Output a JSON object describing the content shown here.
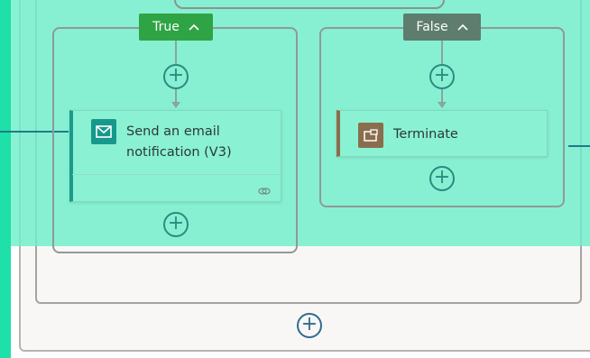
{
  "branches": {
    "true": {
      "label": "True",
      "chevron": "^"
    },
    "false": {
      "label": "False",
      "chevron": "^"
    }
  },
  "cards": {
    "email": {
      "title": "Send an email notification (V3)",
      "icon": "mail-icon",
      "accent": "#16998c"
    },
    "terminate": {
      "title": "Terminate",
      "icon": "terminate-icon",
      "accent": "#8a6d4d"
    }
  },
  "actions": {
    "add_symbol": "+"
  },
  "colors": {
    "left_strip": "#1fe0a8",
    "overlay": "#6feeca",
    "true_pill": "#2fa445",
    "false_pill": "#5e7d6e",
    "connector": "#1f7a8c"
  }
}
